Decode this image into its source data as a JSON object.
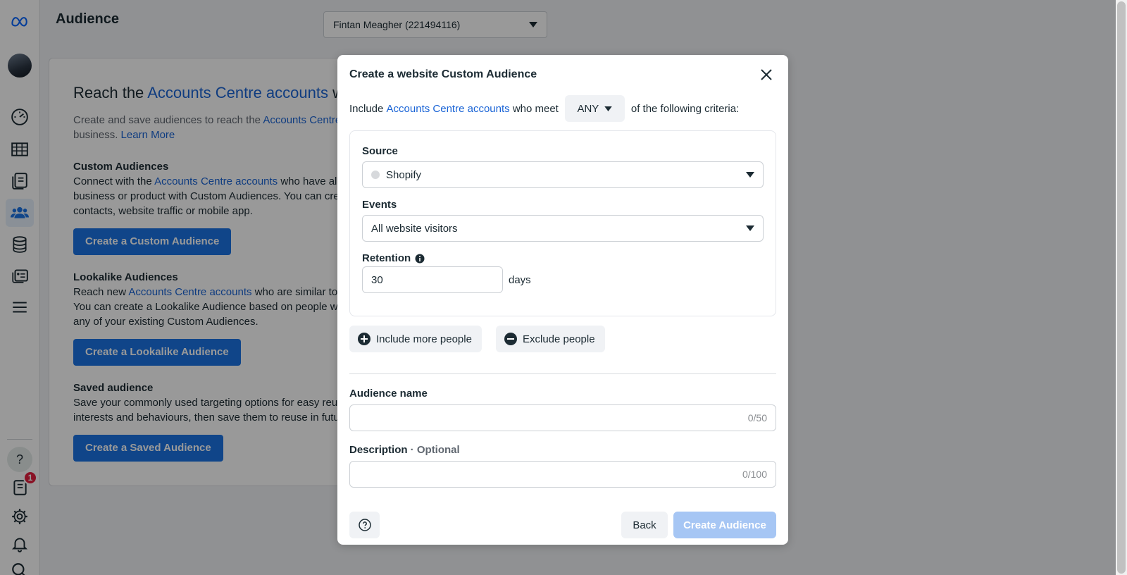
{
  "page": {
    "title": "Audience",
    "account_selector": "Fintan Meagher (221494116)"
  },
  "nav": {
    "notification_count": "1"
  },
  "card": {
    "heading_prefix": "Reach the ",
    "heading_link": "Accounts Centre accounts",
    "heading_suffix": " w",
    "intro_prefix": "Create and save audiences to reach the ",
    "intro_link": "Accounts Centre",
    "intro_line2": "business.",
    "learn_more": "Learn More",
    "custom": {
      "title": "Custom Audiences",
      "line1_prefix": "Connect with the ",
      "line1_link": "Accounts Centre accounts",
      "line1_suffix": " who have alr",
      "line2": "business or product with Custom Audiences. You can cre",
      "line3": "contacts, website traffic or mobile app.",
      "button": "Create a Custom Audience"
    },
    "lookalike": {
      "title": "Lookalike Audiences",
      "line1_prefix": "Reach new ",
      "line1_link": "Accounts Centre accounts",
      "line1_suffix": " who are similar to",
      "line2": "You can create a Lookalike Audience based on people wh",
      "line3": "any of your existing Custom Audiences.",
      "button": "Create a Lookalike Audience"
    },
    "saved": {
      "title": "Saved audience",
      "line1": "Save your commonly used targeting options for easy reus",
      "line2": "interests and behaviours, then save them to reuse in futu",
      "button": "Create a Saved Audience"
    }
  },
  "modal": {
    "title": "Create a website Custom Audience",
    "criteria_prefix": "Include",
    "criteria_link": "Accounts Centre accounts",
    "criteria_mid": "who meet",
    "criteria_match": "ANY",
    "criteria_suffix": "of the following criteria:",
    "source_label": "Source",
    "source_value": "Shopify",
    "events_label": "Events",
    "events_value": "All website visitors",
    "retention_label": "Retention",
    "retention_value": "30",
    "retention_unit": "days",
    "include_more": "Include more people",
    "exclude": "Exclude people",
    "name_label": "Audience name",
    "name_counter": "0/50",
    "desc_label": "Description",
    "desc_optional": "Optional",
    "desc_separator": " · ",
    "desc_counter": "0/100",
    "back": "Back",
    "create": "Create Audience"
  }
}
